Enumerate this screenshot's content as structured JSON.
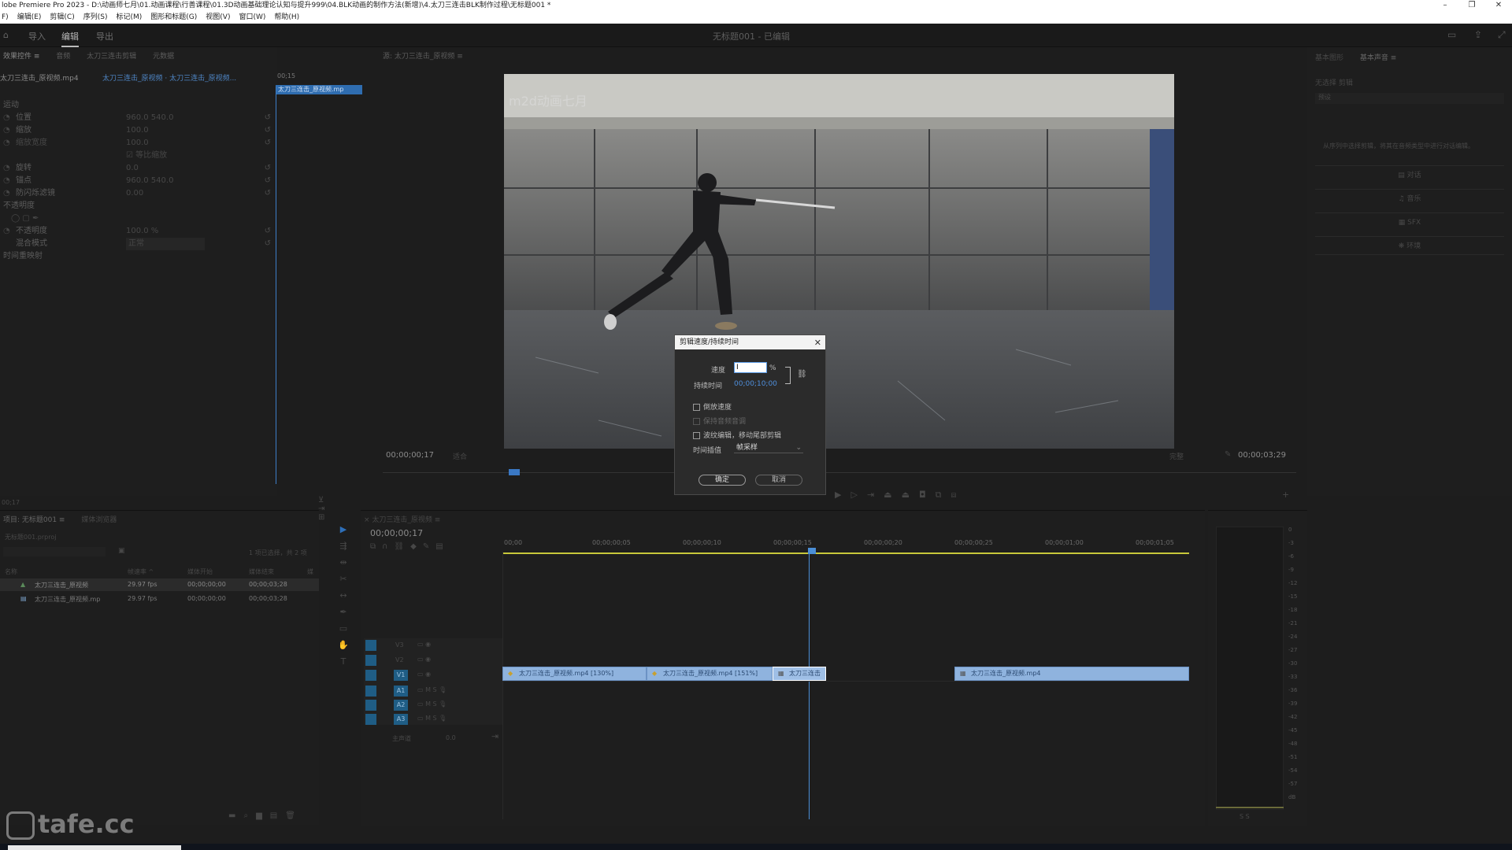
{
  "titlebar": {
    "title": "lobe Premiere Pro 2023 - D:\\动画师七月\\01.动画课程\\行善课程\\01.3D动画基础理论认知与提升999\\04.BLK动画的制作方法(新增)\\4.太刀三连击BLK制作过程\\无标题001 *",
    "minimize": "–",
    "restore": "❐",
    "close": "✕"
  },
  "menu": [
    "F)",
    "编辑(E)",
    "剪辑(C)",
    "序列(S)",
    "标记(M)",
    "图形和标题(G)",
    "视图(V)",
    "窗口(W)",
    "帮助(H)"
  ],
  "workspace": {
    "tabs": [
      "导入",
      "编辑",
      "导出"
    ],
    "active_tab": "编辑",
    "project_title": "无标题001 - 已编辑"
  },
  "effect_controls": {
    "tabs": [
      "效果控件 ≡",
      "音频",
      "太刀三连击剪辑",
      "元数据"
    ],
    "source_clip": "太刀三连击_原视频.mp4",
    "sequence_clip": "太刀三连击_原视频 · 太刀三连击_原视频...",
    "timecode_mini": "00;15",
    "clip_label": "太刀三连击_原视频.mp",
    "section_motion": "运动",
    "props": [
      {
        "name": "位置",
        "value": "960.0    540.0"
      },
      {
        "name": "缩放",
        "value": "100.0"
      },
      {
        "name": "缩放宽度",
        "value": "100.0"
      },
      {
        "name": "☑ 等比缩放",
        "value": ""
      },
      {
        "name": "旋转",
        "value": "0.0"
      },
      {
        "name": "锚点",
        "value": "960.0    540.0"
      },
      {
        "name": "防闪烁滤镜",
        "value": "0.00"
      }
    ],
    "section_opacity": "不透明度",
    "opacity_props": [
      {
        "name": "不透明度",
        "value": "100.0 %"
      },
      {
        "name": "混合模式",
        "value": "正常"
      }
    ],
    "section_time": "时间重映射",
    "timecode_bottom": "00;17"
  },
  "source_monitor": {
    "title": "源: 太刀三连击_原视频 ≡"
  },
  "program_monitor": {
    "video_watermark": "m2d动画七月",
    "timecode_left": "00;00;00;17",
    "fit": "适合",
    "quality": "完整",
    "timecode_right": "00;00;03;29"
  },
  "dialog": {
    "title": "剪辑速度/持续时间",
    "speed_label": "速度",
    "speed_value": "I",
    "speed_unit": "%",
    "duration_label": "持续时间",
    "duration_value": "00;00;10;00",
    "checkboxes": [
      "倒放速度",
      "保持音频音调",
      "波纹编辑，移动尾部剪辑"
    ],
    "interp_label": "时间插值",
    "interp_value": "帧采样",
    "ok": "确定",
    "cancel": "取消"
  },
  "essential_graphics": {
    "tabs": [
      "基本图形",
      "基本声音 ≡"
    ],
    "header": "无选择 剪辑",
    "search_placeholder": "预设",
    "hint": "从序列中选择剪辑，将其在音频类型中进行对话编辑。",
    "buttons": [
      "对话",
      "音乐",
      "SFX",
      "环境"
    ]
  },
  "project": {
    "tabs": [
      "项目: 无标题001 ≡",
      "媒体浏览器"
    ],
    "file": "无标题001.prproj",
    "item_count": "1 项已选择，共 2 项",
    "columns": [
      "名称",
      "帧速率 ^",
      "媒体开始",
      "媒体结束",
      "媒"
    ],
    "rows": [
      {
        "name": "太刀三连击_原视频",
        "fps": "29.97 fps",
        "start": "00;00;00;00",
        "end": "00;00;03;28"
      },
      {
        "name": "太刀三连击_原视频.mp",
        "fps": "29.97 fps",
        "start": "00;00;00;00",
        "end": "00;00;03;28"
      }
    ]
  },
  "timeline": {
    "tab": "太刀三连击_原视频 ≡",
    "timecode": "00;00;00;17",
    "ruler": [
      "00;00",
      "00;00;00;05",
      "00;00;00;10",
      "00;00;00;15",
      "00;00;00;20",
      "00;00;00;25",
      "00;00;01;00",
      "00;00;01;05"
    ],
    "video_tracks": [
      "V3",
      "V2",
      "V1"
    ],
    "audio_tracks": [
      "A1",
      "A2",
      "A3"
    ],
    "master": "主声道",
    "master_value": "0.0",
    "clips": [
      {
        "label": "太刀三连击_原视频.mp4 [130%]"
      },
      {
        "label": "太刀三连击_原视频.mp4 [151%]"
      },
      {
        "label": "太刀三连击"
      },
      {
        "label": "太刀三连击_原视频.mp4"
      }
    ]
  },
  "audio_meter": {
    "labels": [
      "0",
      "-3",
      "-6",
      "-9",
      "-12",
      "-15",
      "-18",
      "-21",
      "-24",
      "-27",
      "-30",
      "-33",
      "-36",
      "-39",
      "-42",
      "-45",
      "-48",
      "-51",
      "-54",
      "-57",
      "dB"
    ]
  },
  "watermark": {
    "text": "tafe.cc"
  }
}
